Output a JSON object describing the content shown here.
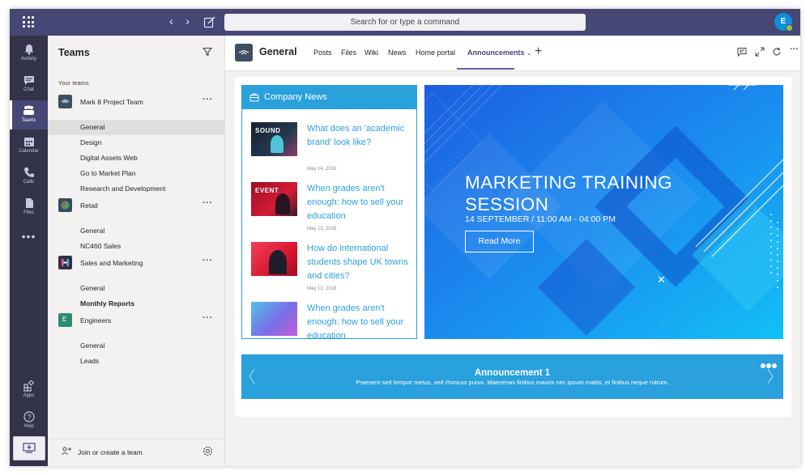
{
  "topbar": {
    "search_placeholder": "Search for or type a command",
    "avatar_initials": "E"
  },
  "appbar": {
    "items": [
      {
        "label": "Activity",
        "icon": "bell-icon"
      },
      {
        "label": "Chat",
        "icon": "chat-icon"
      },
      {
        "label": "Teams",
        "icon": "teams-icon",
        "active": true
      },
      {
        "label": "Calendar",
        "icon": "calendar-icon"
      },
      {
        "label": "Calls",
        "icon": "phone-icon"
      },
      {
        "label": "Files",
        "icon": "files-icon"
      }
    ],
    "more": "•••",
    "apps_label": "Apps",
    "help_label": "Help"
  },
  "leftpanel": {
    "title": "Teams",
    "section_label": "Your teams",
    "teams": [
      {
        "name": "Mark 8 Project Team",
        "channels": [
          "General",
          "Design",
          "Digital Assets Web",
          "Go to Market Plan",
          "Research and Development"
        ]
      },
      {
        "name": "Retail",
        "channels": [
          "General",
          "NC460 Sales"
        ]
      },
      {
        "name": "Sales and Marketing",
        "channels": [
          "General",
          "Monthly Reports"
        ]
      },
      {
        "name": "Engineers",
        "icon_letter": "E",
        "channels": [
          "General",
          "Leads"
        ]
      }
    ],
    "selected_channel": "General",
    "footer_label": "Join or create a team"
  },
  "header": {
    "channel_title": "General",
    "tabs": [
      "Posts",
      "Files",
      "Wiki",
      "News",
      "Home portal",
      "Announcements"
    ],
    "active_tab": "Announcements",
    "add_tab": "+"
  },
  "news": {
    "header_title": "Company News",
    "items": [
      {
        "title": "What does an 'academic brand' look like?",
        "date": "May 14, 2018",
        "thumb_text": "SOUND",
        "thumb_color": "#1b2a3d"
      },
      {
        "title": "When grades aren't enough: how to sell your education",
        "date": "May 13, 2018",
        "thumb_text": "EVENT",
        "thumb_color": "#c4102e"
      },
      {
        "title": "How do international students shape UK towns and cities?",
        "date": "May 12, 2018",
        "thumb_text": "",
        "thumb_color": "#d8182e"
      },
      {
        "title": "When grades aren't enough: how to sell your education",
        "date": "",
        "thumb_text": "",
        "thumb_color": "#6a7ee8"
      }
    ]
  },
  "banner": {
    "title": "MARKETING TRAINING SESSION",
    "subtitle": "14 SEPTEMBER / 11:00 AM - 04:00 PM",
    "button_label": "Read More",
    "close": "✕"
  },
  "carousel": {
    "title": "Announcement 1",
    "text": "Praesent sed tempor metus, sed rhoncus purus. Maecenas finibus mauris nec ipsum mattis, et finibus neque rutrum."
  },
  "colors": {
    "brand": "#464775",
    "accent": "#6264a7",
    "news_blue": "#2aa0dc",
    "banner_blue": "#1c6ee6"
  }
}
